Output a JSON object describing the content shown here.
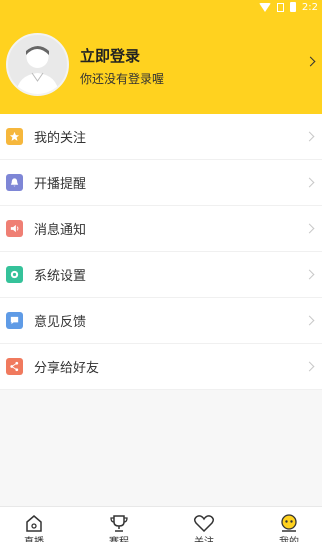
{
  "status_bar": {
    "time": "2:2"
  },
  "profile": {
    "title": "立即登录",
    "subtitle": "你还没有登录喔"
  },
  "menu": [
    {
      "label": "我的关注",
      "icon": "star-icon",
      "color": "#f6b73c"
    },
    {
      "label": "开播提醒",
      "icon": "bell-icon",
      "color": "#7e86d6"
    },
    {
      "label": "消息通知",
      "icon": "speaker-icon",
      "color": "#ef7f74"
    },
    {
      "label": "系统设置",
      "icon": "gear-icon",
      "color": "#35c29a"
    },
    {
      "label": "意见反馈",
      "icon": "feedback-icon",
      "color": "#5f9be6"
    },
    {
      "label": "分享给好友",
      "icon": "share-icon",
      "color": "#f07a5e"
    }
  ],
  "tabs": [
    {
      "label": "直播",
      "icon": "home-icon"
    },
    {
      "label": "赛程",
      "icon": "trophy-icon"
    },
    {
      "label": "关注",
      "icon": "heart-icon"
    },
    {
      "label": "我的",
      "icon": "profile-face-icon"
    }
  ],
  "colors": {
    "accent": "#ffd21f",
    "active_tab": "#ffd21f"
  }
}
